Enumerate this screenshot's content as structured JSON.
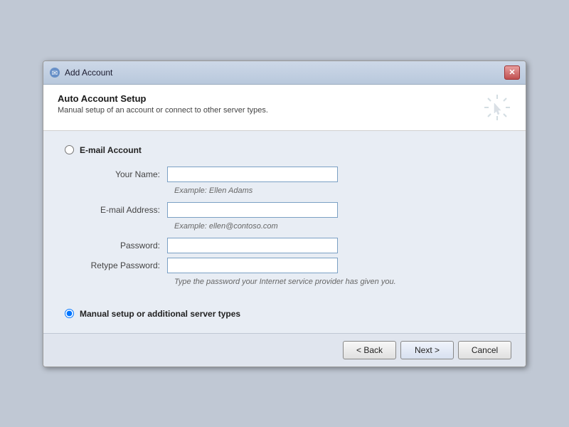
{
  "titleBar": {
    "title": "Add Account",
    "closeLabel": "✕",
    "iconUnicode": "✉"
  },
  "header": {
    "heading": "Auto Account Setup",
    "subtext": "Manual setup of an account or connect to other server types."
  },
  "emailSection": {
    "label": "E-mail Account",
    "radioName": "account-type",
    "radioValue": "email"
  },
  "form": {
    "yourNameLabel": "Your Name:",
    "yourNamePlaceholder": "",
    "yourNameHint": "Example: Ellen Adams",
    "emailAddressLabel": "E-mail Address:",
    "emailAddressPlaceholder": "",
    "emailAddressHint": "Example: ellen@contoso.com",
    "passwordLabel": "Password:",
    "passwordPlaceholder": "",
    "retypePasswordLabel": "Retype Password:",
    "retypePasswordPlaceholder": "",
    "passwordHint": "Type the password your Internet service provider has given you."
  },
  "manualSection": {
    "label": "Manual setup or additional server types",
    "radioName": "account-type",
    "radioValue": "manual",
    "checked": true
  },
  "footer": {
    "backLabel": "< Back",
    "nextLabel": "Next >",
    "cancelLabel": "Cancel"
  }
}
